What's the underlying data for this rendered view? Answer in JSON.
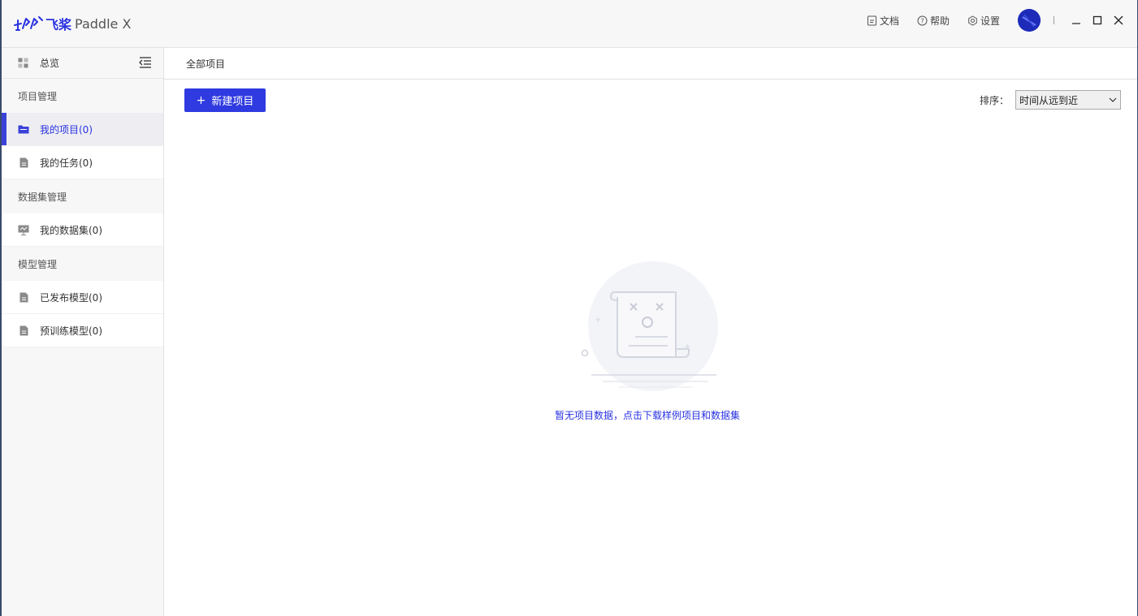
{
  "app": {
    "logo_cn": "飞桨",
    "logo_en": "Paddle X"
  },
  "topbar": {
    "links": [
      {
        "label": "文档",
        "icon": "doc-icon"
      },
      {
        "label": "帮助",
        "icon": "help-icon"
      },
      {
        "label": "设置",
        "icon": "gear-icon"
      }
    ]
  },
  "sidebar": {
    "overview_label": "总览",
    "groups": [
      {
        "title": "项目管理",
        "items": [
          {
            "label": "我的项目(0)",
            "icon": "folder-icon",
            "active": true
          },
          {
            "label": "我的任务(0)",
            "icon": "file-icon"
          }
        ]
      },
      {
        "title": "数据集管理",
        "items": [
          {
            "label": "我的数据集(0)",
            "icon": "dataset-icon"
          }
        ]
      },
      {
        "title": "模型管理",
        "items": [
          {
            "label": "已发布模型(0)",
            "icon": "file-icon"
          },
          {
            "label": "预训练模型(0)",
            "icon": "file-icon"
          }
        ]
      }
    ]
  },
  "main": {
    "breadcrumb": "全部项目",
    "new_project_label": "新建项目",
    "sort_label": "排序：",
    "sort_value": "时间从远到近",
    "empty_text": "暂无项目数据，点击下载样例项目和数据集"
  },
  "colors": {
    "accent": "#2f3ae0",
    "sidebar_bg": "#f7f7f8"
  }
}
